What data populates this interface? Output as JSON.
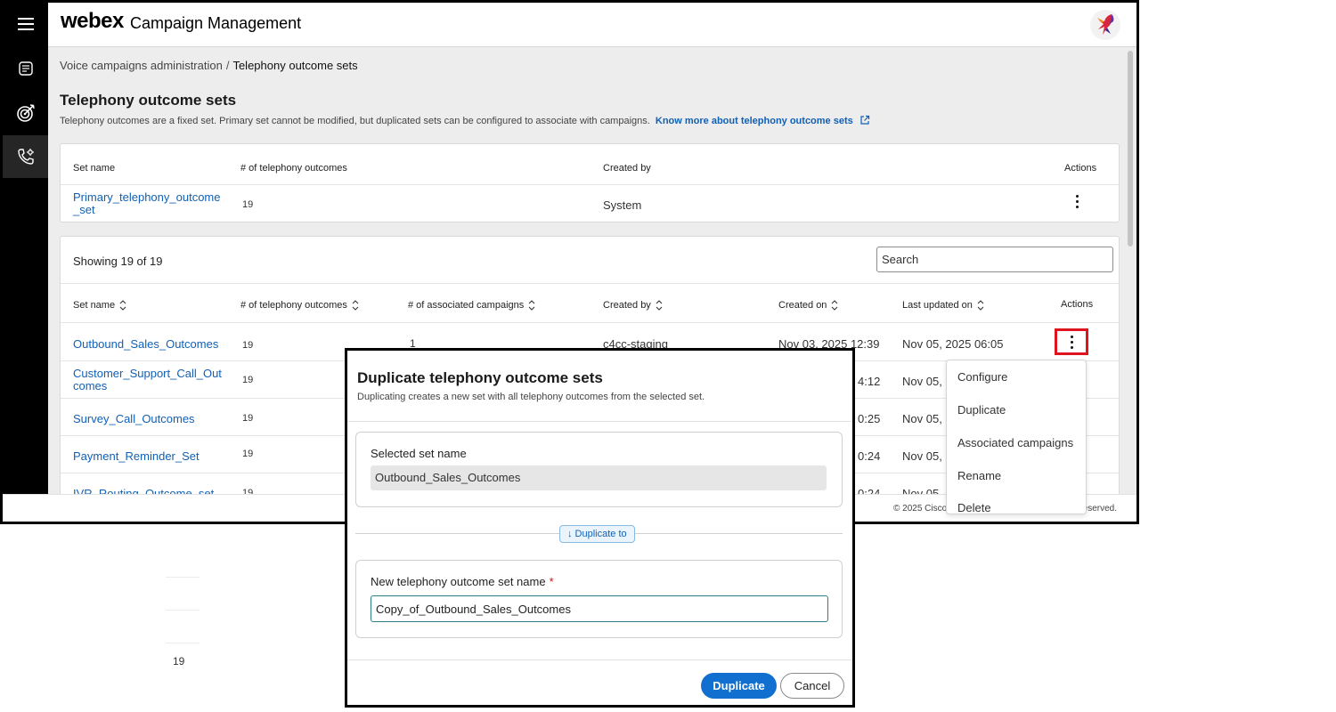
{
  "header": {
    "logo": "webex",
    "app_title": "Campaign Management"
  },
  "breadcrumb": {
    "parent": "Voice campaigns administration",
    "separator": "/",
    "current": "Telephony outcome sets"
  },
  "page": {
    "title": "Telephony outcome sets",
    "description": "Telephony outcomes are a fixed set. Primary set cannot be modified, but duplicated sets can be configured to associate with campaigns.",
    "know_more_link": "Know more about telephony outcome sets"
  },
  "primary_table": {
    "columns": [
      "Set name",
      "# of telephony outcomes",
      "Created by",
      "Actions"
    ],
    "row": {
      "name_line1": "Primary_telephony_outcome",
      "name_line2": "_set",
      "outcomes": "19",
      "created_by": "System"
    }
  },
  "list": {
    "showing": "Showing 19 of 19",
    "search_placeholder": "Search",
    "columns": [
      "Set name",
      "# of telephony outcomes",
      "# of associated campaigns",
      "Created by",
      "Created on",
      "Last updated on",
      "Actions"
    ],
    "rows": [
      {
        "name_line1": "Outbound_Sales_Outcomes",
        "name_line2": "",
        "outcomes": "19",
        "campaigns": "1",
        "created_by": "c4cc-staging",
        "created_on": "Nov 03, 2025 12:39",
        "updated_on": "Nov 05, 2025 06:05"
      },
      {
        "name_line1": "Customer_Support_Call_Out",
        "name_line2": "comes",
        "outcomes": "19",
        "created_on_tail": "4:12",
        "updated_on": "Nov 05,"
      },
      {
        "name_line1": "Survey_Call_Outcomes",
        "name_line2": "",
        "outcomes": "19",
        "created_on_tail": "0:25",
        "updated_on": "Nov 05,"
      },
      {
        "name_line1": "Payment_Reminder_Set",
        "name_line2": "",
        "outcomes": "19",
        "created_on_tail": "0:24",
        "updated_on": "Nov 05,"
      },
      {
        "name_line1": "IVR_Routing_Outcome_set",
        "name_line2": "",
        "outcomes": "19",
        "created_on_tail": "0:24",
        "updated_on": "Nov 05,"
      }
    ]
  },
  "footer": {
    "copyright_start": "© 2025 Cisco S",
    "copyright_end": "eserved."
  },
  "action_menu": {
    "items": [
      "Configure",
      "Duplicate",
      "Associated campaigns",
      "Rename",
      "Delete"
    ]
  },
  "background": {
    "stray_value": "19"
  },
  "dialog": {
    "title": "Duplicate telephony outcome sets",
    "subtitle": "Duplicating creates a new set with all telephony outcomes from the selected set.",
    "selected_label": "Selected set name",
    "selected_value": "Outbound_Sales_Outcomes",
    "duplicate_to": "↓ Duplicate to",
    "new_name_label": "New telephony outcome set name",
    "required_mark": "*",
    "new_name_value": "Copy_of_Outbound_Sales_Outcomes",
    "primary_button": "Duplicate",
    "secondary_button": "Cancel"
  },
  "icons": {
    "menu": "hamburger-menu-icon",
    "nav1": "list-document-icon",
    "nav2": "target-icon",
    "nav3": "phone-settings-icon",
    "external": "external-link-icon",
    "sort": "sort-icon",
    "more": "more-vertical-icon"
  },
  "colors": {
    "link": "#1160b4",
    "primary_button": "#1170cf",
    "highlight": "#e0141e",
    "required": "#d0101a",
    "sidebar": "#000000"
  }
}
